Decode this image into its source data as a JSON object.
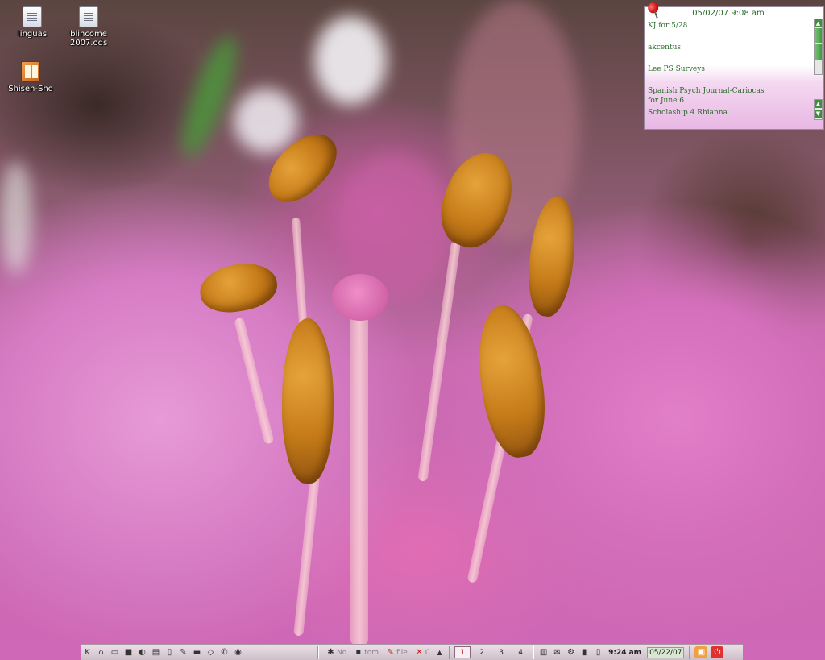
{
  "desktop": {
    "icons": [
      {
        "label": "linguas",
        "icon": "document-icon"
      },
      {
        "label": "blincome2007.ods",
        "icon": "spreadsheet-icon"
      },
      {
        "label": "Shisen-Sho",
        "icon": "game-icon"
      }
    ]
  },
  "note": {
    "date": "05/02/07 9:08 am",
    "lines": [
      "KJ for 5/28",
      "akcentus",
      "Lee PS Surveys",
      "Spanish Psych Journal-Cariocas for June 6",
      "Scholaship 4 Rhianna"
    ],
    "pin_icon": "pushpin-icon",
    "scroll_up": "▲",
    "scroll_down": "▼"
  },
  "taskbar": {
    "launchers": [
      "k-menu-icon",
      "home-icon",
      "folder-icon",
      "terminal-icon",
      "konqueror-icon",
      "text-editor-icon",
      "document-icon",
      "writer-icon",
      "presentation-icon",
      "note-icon",
      "kopete-icon",
      "network-icon"
    ],
    "tasks": [
      {
        "label": "No",
        "icon": "app-icon"
      },
      {
        "label": "tom",
        "icon": "terminal-icon"
      },
      {
        "label": "file",
        "icon": "file-icon"
      },
      {
        "label": "C",
        "icon": "close-app-icon"
      }
    ],
    "desktops": [
      "1",
      "2",
      "3",
      "4"
    ],
    "active_desktop": "1",
    "tray_icons": [
      "clipboard-icon",
      "mail-icon",
      "network-tray-icon",
      "usb-icon",
      "battery-icon"
    ],
    "time": "9:24 am",
    "date": "05/22/07",
    "lock_icon": "lock-icon",
    "logout_icon": "logout-icon"
  },
  "colors": {
    "note_text": "#2a6a2a",
    "taskbar_bg": "#ddd0d8",
    "active_desktop": "#c00000"
  }
}
